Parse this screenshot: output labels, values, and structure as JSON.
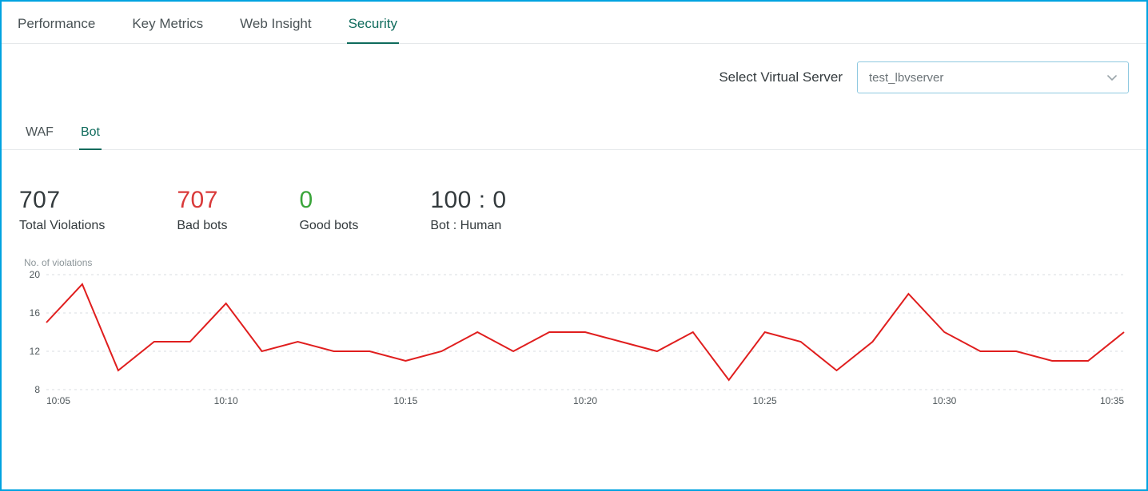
{
  "top_tabs": [
    {
      "label": "Performance"
    },
    {
      "label": "Key Metrics"
    },
    {
      "label": "Web Insight"
    },
    {
      "label": "Security",
      "active": true
    }
  ],
  "server_selector": {
    "label": "Select Virtual Server",
    "selected": "test_lbvserver"
  },
  "sub_tabs": [
    {
      "label": "WAF"
    },
    {
      "label": "Bot",
      "active": true
    }
  ],
  "stats": [
    {
      "value": "707",
      "label": "Total Violations",
      "color": ""
    },
    {
      "value": "707",
      "label": "Bad bots",
      "color": "red"
    },
    {
      "value": "0",
      "label": "Good bots",
      "color": "green"
    },
    {
      "value": "100 : 0",
      "label": "Bot : Human",
      "color": ""
    }
  ],
  "chart_data": {
    "type": "line",
    "title": "No. of violations",
    "ylabel": "No. of violations",
    "xlabel": "",
    "ylim": [
      8,
      20
    ],
    "y_ticks": [
      8,
      12,
      16,
      20
    ],
    "x_ticks": [
      "10:05",
      "10:10",
      "10:15",
      "10:20",
      "10:25",
      "10:30",
      "10:35"
    ],
    "x": [
      "10:05",
      "10:06",
      "10:07",
      "10:08",
      "10:09",
      "10:10",
      "10:11",
      "10:12",
      "10:13",
      "10:14",
      "10:15",
      "10:16",
      "10:17",
      "10:18",
      "10:19",
      "10:20",
      "10:21",
      "10:22",
      "10:23",
      "10:24",
      "10:25",
      "10:26",
      "10:27",
      "10:28",
      "10:29",
      "10:30",
      "10:31",
      "10:32",
      "10:33",
      "10:34",
      "10:35"
    ],
    "series": [
      {
        "name": "Violations",
        "color": "#e01e1e",
        "values": [
          15,
          19,
          10,
          13,
          13,
          17,
          12,
          13,
          12,
          12,
          11,
          12,
          14,
          12,
          14,
          14,
          13,
          12,
          14,
          9,
          14,
          13,
          10,
          13,
          18,
          14,
          12,
          12,
          11,
          11,
          14
        ]
      }
    ]
  }
}
